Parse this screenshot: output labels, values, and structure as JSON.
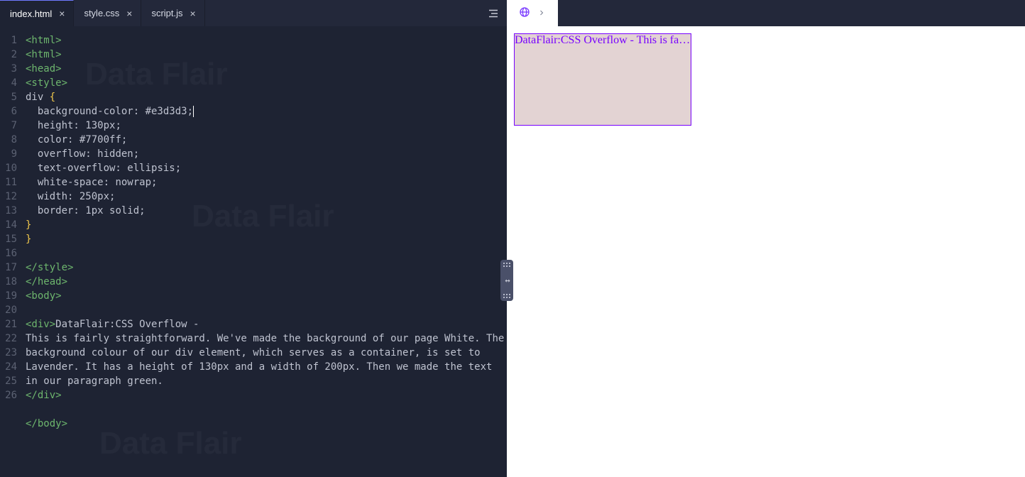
{
  "tabs": [
    {
      "label": "index.html",
      "active": true,
      "closable": true
    },
    {
      "label": "style.css",
      "active": false,
      "closable": true
    },
    {
      "label": "script.js",
      "active": false,
      "closable": true
    }
  ],
  "code_lines": [
    {
      "n": "1",
      "segments": [
        [
          "tag",
          "<html>"
        ]
      ]
    },
    {
      "n": "2",
      "segments": [
        [
          "tag",
          "<html>"
        ]
      ]
    },
    {
      "n": "3",
      "segments": [
        [
          "tag",
          "<head>"
        ]
      ]
    },
    {
      "n": "4",
      "segments": [
        [
          "tag",
          "<style>"
        ]
      ]
    },
    {
      "n": "5",
      "segments": [
        [
          "sel",
          "div "
        ],
        [
          "bracket",
          "{"
        ]
      ]
    },
    {
      "n": "6",
      "segments": [
        [
          "prop",
          "  background-color: "
        ],
        [
          "val",
          "#e3d3d3"
        ],
        [
          "punct",
          ";"
        ],
        [
          "caret",
          ""
        ]
      ]
    },
    {
      "n": "7",
      "segments": [
        [
          "prop",
          "  height: "
        ],
        [
          "val",
          "130px"
        ],
        [
          "punct",
          ";"
        ]
      ]
    },
    {
      "n": "8",
      "segments": [
        [
          "prop",
          "  color: "
        ],
        [
          "val",
          "#7700ff"
        ],
        [
          "punct",
          ";"
        ]
      ]
    },
    {
      "n": "9",
      "segments": [
        [
          "prop",
          "  overflow: "
        ],
        [
          "val",
          "hidden"
        ],
        [
          "punct",
          ";"
        ]
      ]
    },
    {
      "n": "10",
      "segments": [
        [
          "prop",
          "  text-overflow: "
        ],
        [
          "val",
          "ellipsis"
        ],
        [
          "punct",
          ";"
        ]
      ]
    },
    {
      "n": "11",
      "segments": [
        [
          "prop",
          "  white-space: "
        ],
        [
          "val",
          "nowrap"
        ],
        [
          "punct",
          ";"
        ]
      ]
    },
    {
      "n": "12",
      "segments": [
        [
          "prop",
          "  width: "
        ],
        [
          "val",
          "250px"
        ],
        [
          "punct",
          ";"
        ]
      ]
    },
    {
      "n": "13",
      "segments": [
        [
          "prop",
          "  border: "
        ],
        [
          "val",
          "1px solid"
        ],
        [
          "punct",
          ";"
        ]
      ]
    },
    {
      "n": "14",
      "segments": [
        [
          "bracket",
          "}"
        ]
      ]
    },
    {
      "n": "15",
      "segments": [
        [
          "bracket",
          "}"
        ]
      ]
    },
    {
      "n": "16",
      "segments": []
    },
    {
      "n": "17",
      "segments": [
        [
          "tag",
          "</style>"
        ]
      ]
    },
    {
      "n": "18",
      "segments": [
        [
          "tag",
          "</head>"
        ]
      ]
    },
    {
      "n": "19",
      "segments": [
        [
          "tag",
          "<body>"
        ]
      ]
    },
    {
      "n": "20",
      "segments": []
    },
    {
      "n": "21",
      "segments": [
        [
          "tag",
          "<div>"
        ],
        [
          "text",
          "DataFlair:CSS Overflow -"
        ]
      ]
    },
    {
      "n": "22",
      "segments": [
        [
          "text",
          "This is fairly straightforward. We've made the background of our page White. The background colour of our div element, which serves as a container, is set to Lavender. It has a height of 130px and a width of 200px. Then we made the text in our paragraph green."
        ]
      ]
    },
    {
      "n": "23",
      "segments": [
        [
          "tag",
          "</div>"
        ]
      ]
    },
    {
      "n": "24",
      "segments": []
    },
    {
      "n": "25",
      "segments": [
        [
          "tag",
          "</body>"
        ]
      ]
    },
    {
      "n": "26",
      "segments": []
    }
  ],
  "preview": {
    "rendered_text": "DataFlair:CSS Overflow - This is fairly straightforward. We've made the background of our page White."
  },
  "watermark": "Data Flair"
}
